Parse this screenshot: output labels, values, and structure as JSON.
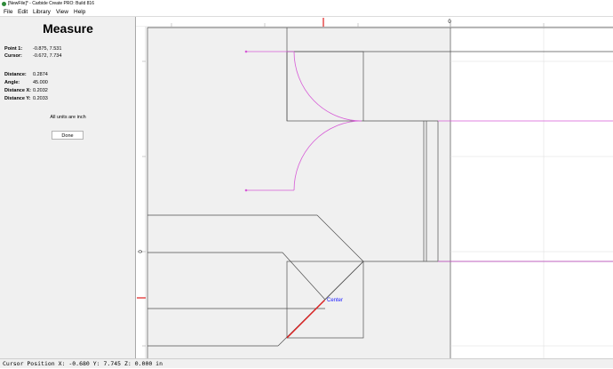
{
  "window": {
    "title": "[NewFile]* - Carbide Create PRO: Build 816"
  },
  "menu": [
    "File",
    "Edit",
    "Library",
    "View",
    "Help"
  ],
  "panel": {
    "title": "Measure",
    "point1_label": "Point 1:",
    "point1_value": "-0.875, 7.531",
    "cursor_label": "Cursor:",
    "cursor_value": "-0.672, 7.734",
    "distance_label": "Distance:",
    "distance_value": "0.2874",
    "angle_label": "Angle:",
    "angle_value": "45.000",
    "distance_x_label": "Distance X:",
    "distance_x_value": "0.2032",
    "distance_y_label": "Distance Y:",
    "distance_y_value": "0.2033",
    "units_note": "All units are inch",
    "done_label": "Done"
  },
  "canvas": {
    "ruler_top_zero": "0",
    "ruler_left_zero": "0",
    "center_label": "Center",
    "colors": {
      "geometry": "#505050",
      "toolpath": "#d65ad6",
      "measure_line": "#e02020",
      "center_text": "#1a1aff",
      "work_area": "#f0f0f0"
    }
  },
  "status": {
    "text": "Cursor Position X: -0.680 Y: 7.745 Z: 0.000 in"
  }
}
